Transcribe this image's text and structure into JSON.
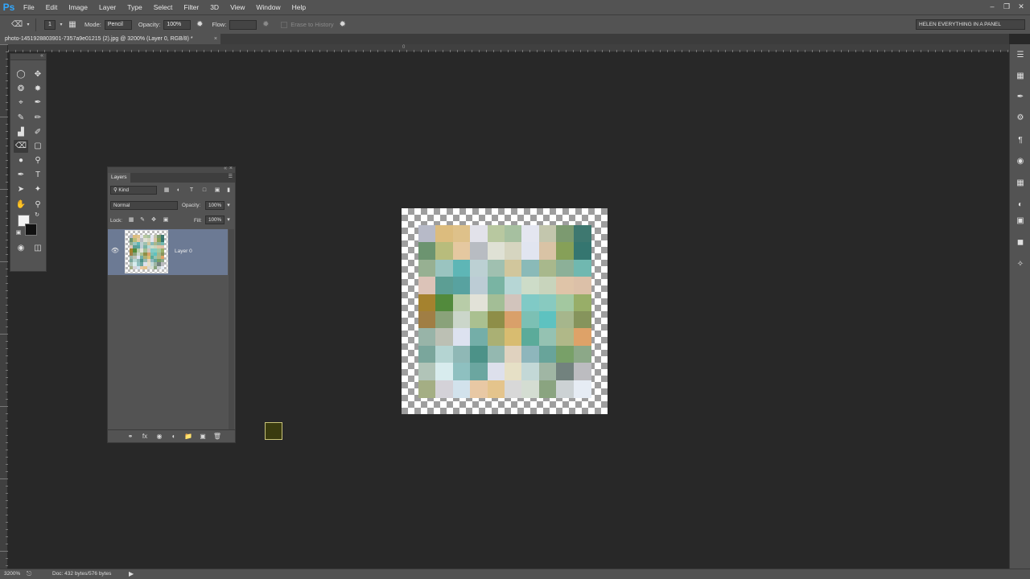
{
  "app": {
    "logo": "Ps"
  },
  "menu": [
    "File",
    "Edit",
    "Image",
    "Layer",
    "Type",
    "Select",
    "Filter",
    "3D",
    "View",
    "Window",
    "Help"
  ],
  "window_controls": {
    "minimize": "–",
    "restore": "❐",
    "close": "✕"
  },
  "options": {
    "brush_size": "1",
    "mode_label": "Mode:",
    "mode_value": "Pencil",
    "opacity_label": "Opacity:",
    "opacity_value": "100%",
    "flow_label": "Flow:",
    "flow_value": "",
    "erase_history_label": "Erase to History",
    "workspace": "HELEN EVERYTHING IN A PANEL"
  },
  "document": {
    "tab_title": "photo-1451928803901-7357a9e01215 (2).jpg @ 3200% (Layer 0, RGB/8) *",
    "tab_close": "×",
    "ruler_zero": "0"
  },
  "layers_panel": {
    "tab": "Layers",
    "collapse": "«",
    "close": "×",
    "filter_kind": "Kind",
    "blend_mode": "Normal",
    "opacity_label": "Opacity:",
    "opacity_value": "100%",
    "lock_label": "Lock:",
    "fill_label": "Fill:",
    "fill_value": "100%",
    "layer_name": "Layer 0"
  },
  "status": {
    "zoom": "3200%",
    "doc_info": "Doc: 432 bytes/576 bytes",
    "arrow": "▶"
  },
  "image_pixels": [
    [
      "#b7bac8",
      "#dcbc7e",
      "#dec18a",
      "#e2e2ea",
      "#b8c8a0",
      "#a6c0a0",
      "#e4e6f0",
      "#c3c6ad",
      "#7c9a70",
      "#3e7870"
    ],
    [
      "#6c9470",
      "#b8bc7c",
      "#e5c8a0",
      "#b8bcc2",
      "#dfe1d5",
      "#d6d5c0",
      "#e1e5f0",
      "#d9c3a5",
      "#86a058",
      "#357670"
    ],
    [
      "#97b092",
      "#9ac4c0",
      "#5eb6b6",
      "#bcd0d3",
      "#a0c0b0",
      "#d1c69c",
      "#8abab8",
      "#a8b88c",
      "#8cb098",
      "#70b8b0"
    ],
    [
      "#dcc3b8",
      "#5c9e94",
      "#58a2a0",
      "#bcccd5",
      "#79b4a3",
      "#b6d6d5",
      "#cddcc8",
      "#c8d4bc",
      "#dfc4a8",
      "#dcc0a8"
    ],
    [
      "#a5822e",
      "#528a3c",
      "#b8cca8",
      "#e2e2d8",
      "#a3be96",
      "#d2c4bc",
      "#80cac6",
      "#88cac0",
      "#a3c8a0",
      "#98ae68"
    ],
    [
      "#a07e44",
      "#8aa27a",
      "#cbd6ca",
      "#aac090",
      "#8e8e48",
      "#d9a06a",
      "#7cc0b4",
      "#5ec2c0",
      "#a6b68c",
      "#86945c"
    ],
    [
      "#98b4a8",
      "#bcc0b4",
      "#dde2f0",
      "#74aea8",
      "#aab074",
      "#d8bc70",
      "#5bab9a",
      "#95c2b2",
      "#b0b888",
      "#dea268"
    ],
    [
      "#7aa69c",
      "#b4d4d2",
      "#8fb8b6",
      "#4c9288",
      "#94b8b0",
      "#e0d2bf",
      "#8eb6bc",
      "#68a49a",
      "#78a068",
      "#8ca888"
    ],
    [
      "#b1c4b8",
      "#d8ecee",
      "#8ec0c0",
      "#6ba6a0",
      "#dde0ec",
      "#e6e0c6",
      "#c3d8d7",
      "#a0b6a4",
      "#72827e",
      "#bcbcc0"
    ],
    [
      "#a4ae84",
      "#d4d2d8",
      "#d2e2ec",
      "#e8c8a4",
      "#e4c48c",
      "#d8d8d8",
      "#d4ddd2",
      "#8aa480",
      "#ccd2d4",
      "#e6ecf4"
    ]
  ],
  "layer_thumb_colors": [
    "#6cb8ae",
    "#dcbc7e",
    "#52a2a0",
    "#b8c8a0",
    "#e2e2ea",
    "#8cb098"
  ]
}
